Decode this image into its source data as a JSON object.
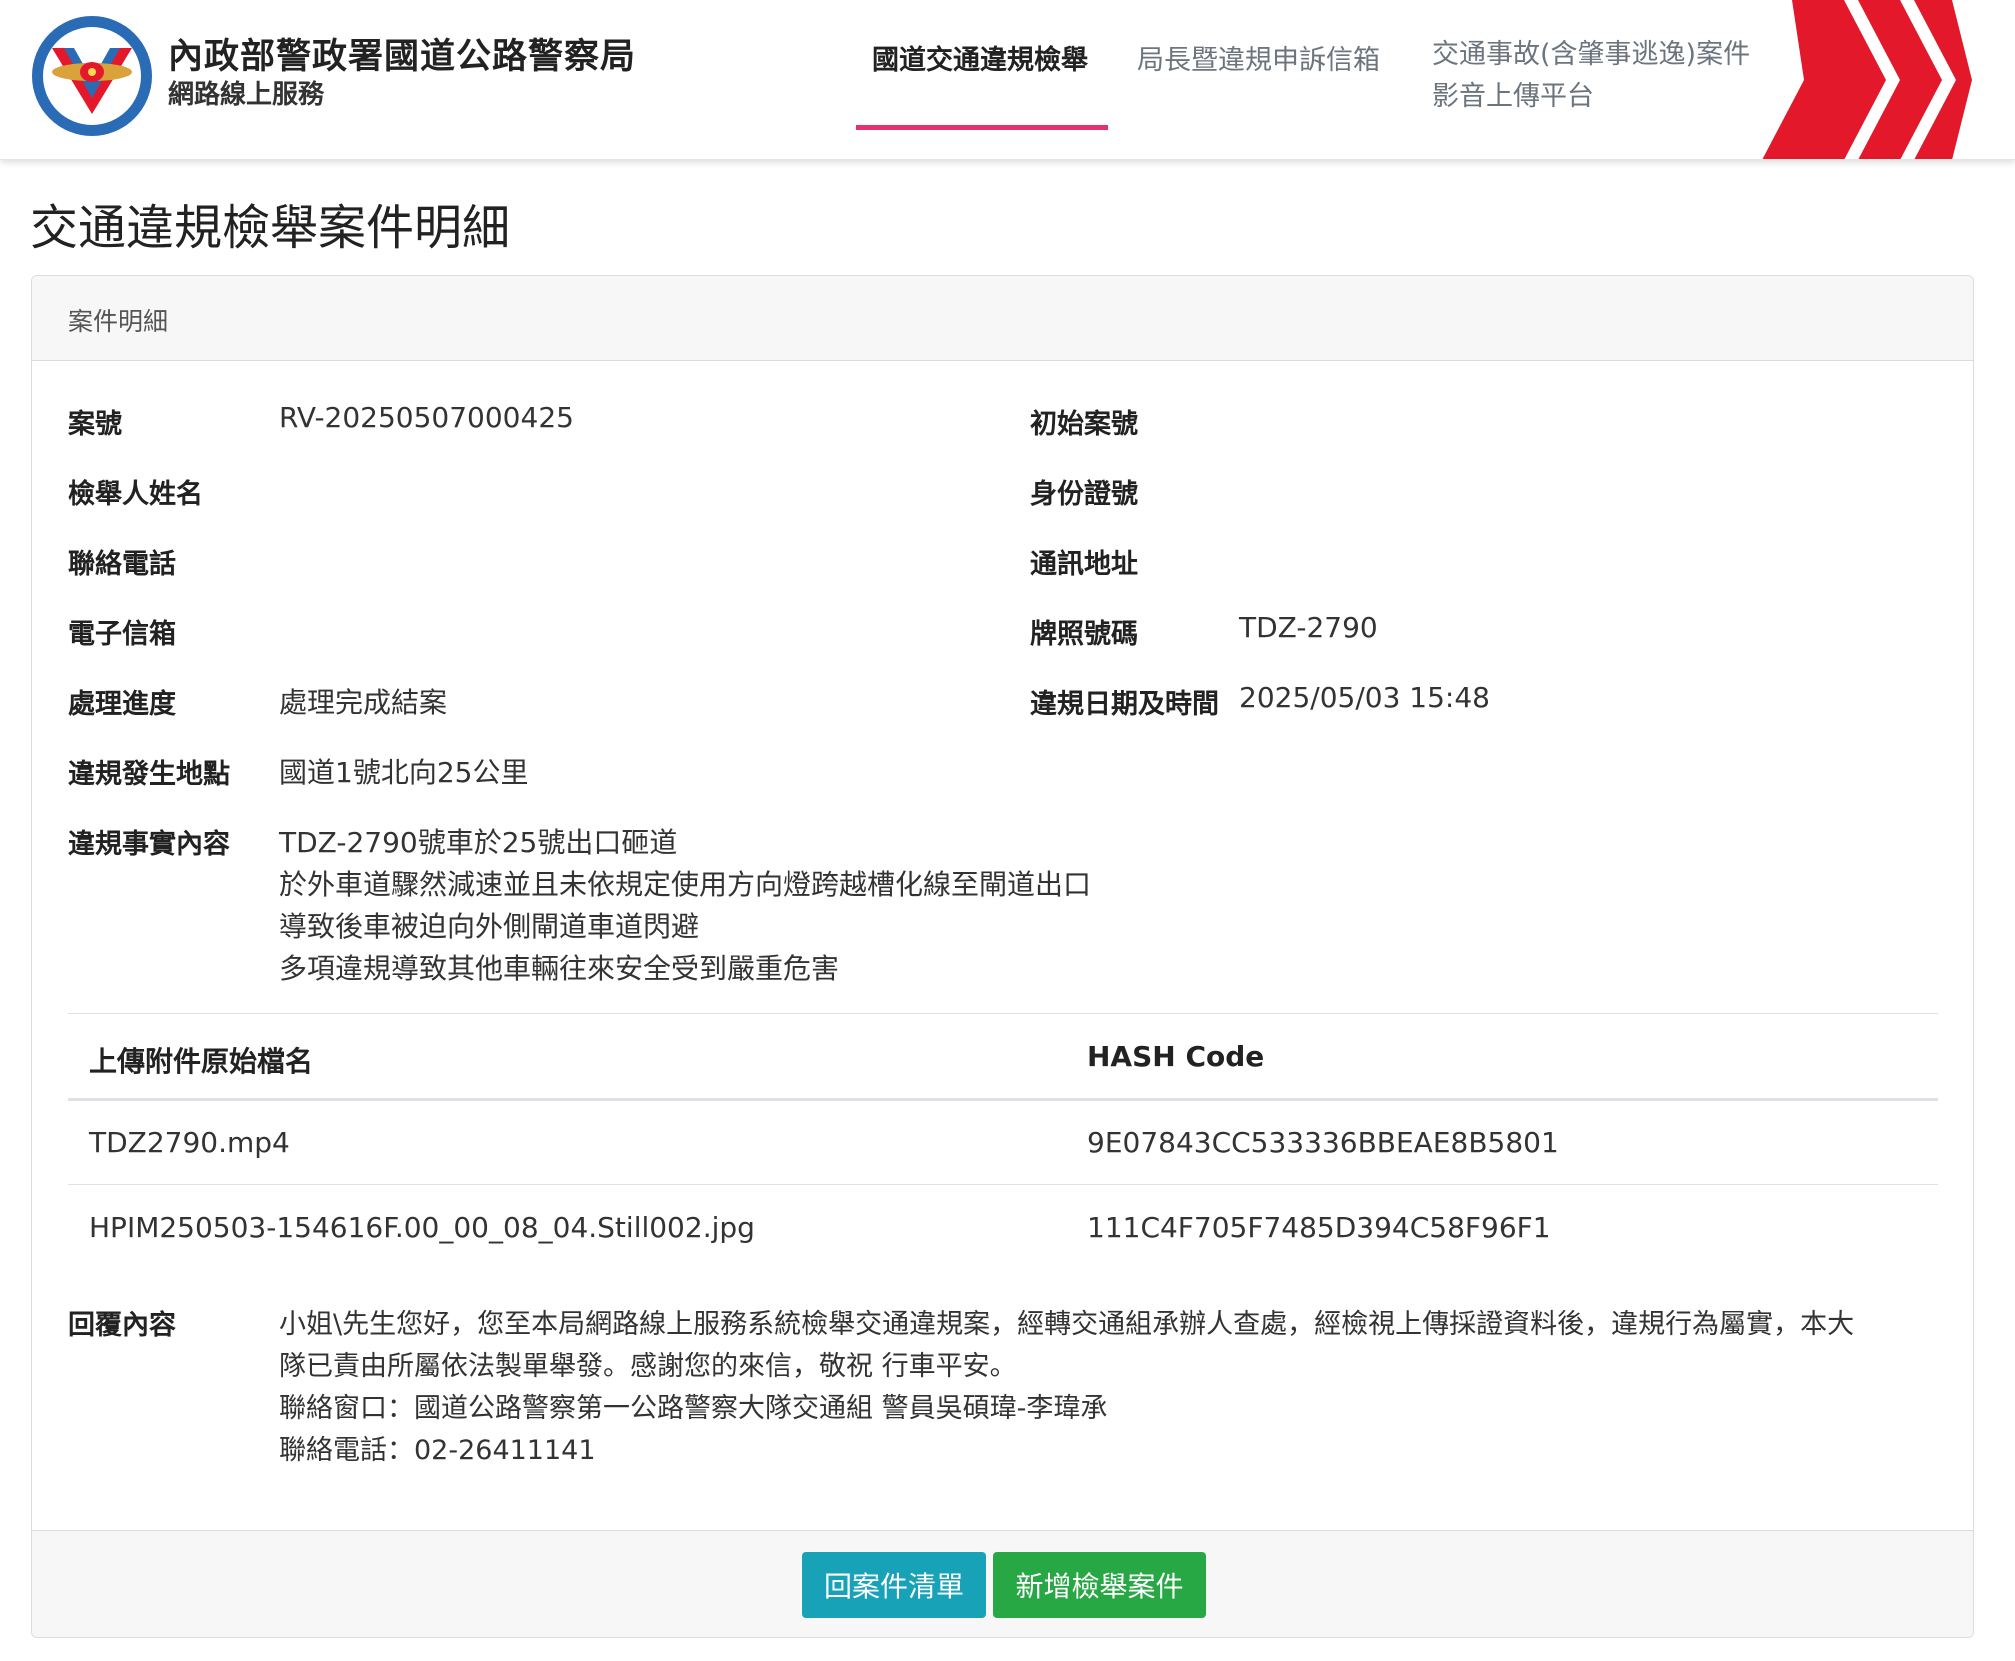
{
  "header": {
    "brand_title": "內政部警政署國道公路警察局",
    "brand_subtitle": "網路線上服務",
    "nav": [
      {
        "label": "國道交通違規檢舉",
        "active": true
      },
      {
        "label": "局長暨違規申訴信箱",
        "active": false
      },
      {
        "label_line1": "交通事故(含肇事逃逸)案件",
        "label_line2": "影音上傳平台",
        "active": false
      }
    ],
    "accent_color": "#e8306a",
    "chevron_color": "#e3192b"
  },
  "page": {
    "title": "交通違規檢舉案件明細"
  },
  "card": {
    "header": "案件明細",
    "fields": {
      "case_no": {
        "label": "案號",
        "value": "RV-20250507000425"
      },
      "initial_case_no": {
        "label": "初始案號",
        "value": ""
      },
      "reporter_name": {
        "label": "檢舉人姓名",
        "value": ""
      },
      "id_no": {
        "label": "身份證號",
        "value": ""
      },
      "phone": {
        "label": "聯絡電話",
        "value": ""
      },
      "address": {
        "label": "通訊地址",
        "value": ""
      },
      "email": {
        "label": "電子信箱",
        "value": ""
      },
      "plate": {
        "label": "牌照號碼",
        "value": "TDZ-2790"
      },
      "progress": {
        "label": "處理進度",
        "value": "處理完成結案"
      },
      "datetime": {
        "label": "違規日期及時間",
        "value": "2025/05/03 15:48"
      },
      "location": {
        "label": "違規發生地點",
        "value": "國道1號北向25公里"
      },
      "facts": {
        "label": "違規事實內容",
        "lines": [
          "TDZ-2790號車於25號出口砸道",
          "於外車道驟然減速並且未依規定使用方向燈跨越槽化線至閘道出口",
          "導致後車被迫向外側閘道車道閃避",
          "多項違規導致其他車輛往來安全受到嚴重危害"
        ]
      }
    },
    "attachments": {
      "headers": [
        "上傳附件原始檔名",
        "HASH Code"
      ],
      "rows": [
        [
          "TDZ2790.mp4",
          "9E07843CC533336BBEAE8B5801"
        ],
        [
          "HPIM250503-154616F.00_00_08_04.Still002.jpg",
          "111C4F705F7485D394C58F96F1"
        ]
      ]
    },
    "reply": {
      "label": "回覆內容",
      "lines": [
        "小姐\\先生您好，您至本局網路線上服務系統檢舉交通違規案，經轉交通組承辦人查處，經檢視上傳採證資料後，違規行為屬實，本大",
        "隊已責由所屬依法製單舉發。感謝您的來信，敬祝 行車平安。",
        "聯絡窗口：國道公路警察第一公路警察大隊交通組 警員吳碩瑋-李瑋承",
        "聯絡電話：02-26411141"
      ]
    },
    "buttons": {
      "back": "回案件清單",
      "new_report": "新增檢舉案件"
    }
  }
}
